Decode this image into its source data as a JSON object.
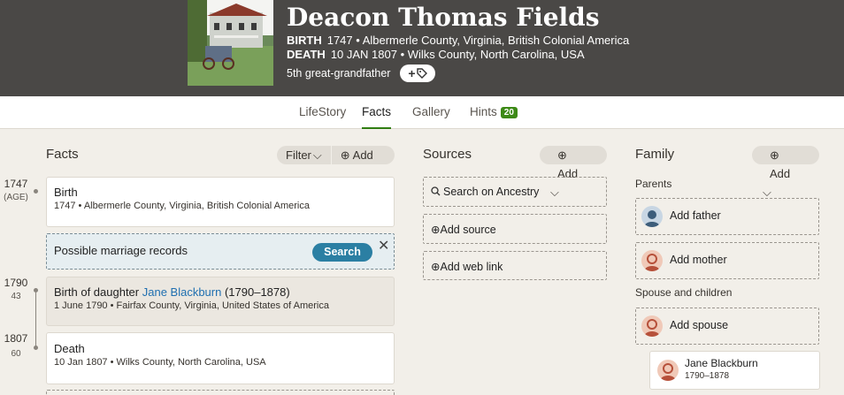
{
  "header": {
    "name": "Deacon Thomas Fields",
    "birth_label": "BIRTH",
    "birth_value": "1747 • Albermerle County, Virginia, British Colonial America",
    "death_label": "DEATH",
    "death_value": "10 JAN 1807 • Wilks County, North Carolina, USA",
    "relationship": "5th great-grandfather",
    "tag_button_label": "+"
  },
  "tabs": [
    {
      "label": "LifeStory"
    },
    {
      "label": "Facts"
    },
    {
      "label": "Gallery"
    },
    {
      "label": "Hints",
      "badge": "20"
    }
  ],
  "facts": {
    "title": "Facts",
    "filter_label": "Filter",
    "add_label": "Add",
    "timeline": [
      {
        "year": "1747",
        "age": "(AGE)"
      },
      {
        "year": "1790",
        "age": "43"
      },
      {
        "year": "1807",
        "age": "60"
      }
    ],
    "items": [
      {
        "title": "Birth",
        "detail": "1747 • Albermerle County, Virginia, British Colonial America"
      },
      {
        "title_prefix": "Birth of daughter ",
        "title_link": "Jane Blackburn",
        "title_suffix": " (1790–1878)",
        "detail": "1 June 1790 • Fairfax County, Virginia, United States of America"
      },
      {
        "title": "Death",
        "detail": "10 Jan 1807 • Wilks County, North Carolina, USA"
      }
    ],
    "hint": {
      "text": "Possible marriage records",
      "button": "Search",
      "close": "✕"
    }
  },
  "sources": {
    "title": "Sources",
    "add_label": "Add",
    "items": [
      {
        "label": "Search on Ancestry"
      },
      {
        "label": "Add source"
      },
      {
        "label": "Add web link"
      }
    ]
  },
  "family": {
    "title": "Family",
    "add_label": "Add",
    "parents_label": "Parents",
    "add_father": "Add father",
    "add_mother": "Add mother",
    "spouse_label": "Spouse and children",
    "add_spouse": "Add spouse",
    "child": {
      "name": "Jane Blackburn",
      "years": "1790–1878"
    }
  },
  "colors": {
    "header_bg": "#4a4846",
    "page_bg": "#f2efe9",
    "accent_green": "#3d8a17",
    "search_blue": "#2b7fa3",
    "link_blue": "#1f6fb0"
  }
}
